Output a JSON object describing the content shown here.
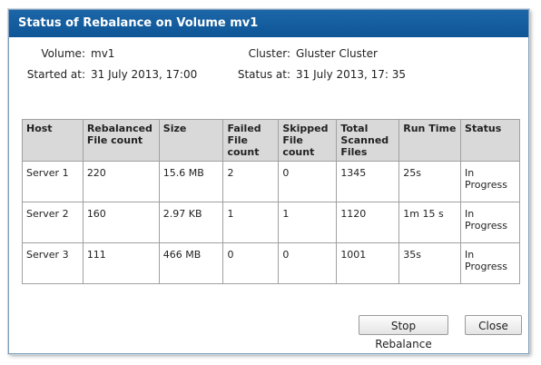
{
  "dialog": {
    "title": "Status of Rebalance on Volume mv1"
  },
  "info": {
    "volume_label": "Volume:",
    "volume_value": "mv1",
    "cluster_label": "Cluster:",
    "cluster_value": "Gluster Cluster",
    "started_label": "Started at:",
    "started_value": "31 July 2013, 17:00",
    "status_label": "Status at:",
    "status_value": "31 July 2013, 17: 35"
  },
  "table": {
    "headers": [
      "Host",
      "Rebalanced File count",
      "Size",
      "Failed File count",
      "Skipped File count",
      "Total Scanned Files",
      "Run Time",
      "Status"
    ],
    "rows": [
      [
        "Server 1",
        "220",
        "15.6 MB",
        "2",
        "0",
        "1345",
        "25s",
        "In Progress"
      ],
      [
        "Server 2",
        "160",
        "2.97 KB",
        "1",
        "1",
        "1120",
        "1m 15 s",
        "In Progress"
      ],
      [
        "Server 3",
        "111",
        "466 MB",
        "0",
        "0",
        "1001",
        "35s",
        "In Progress"
      ]
    ]
  },
  "buttons": {
    "stop_label": "Stop Rebalance",
    "close_label": "Close"
  }
}
